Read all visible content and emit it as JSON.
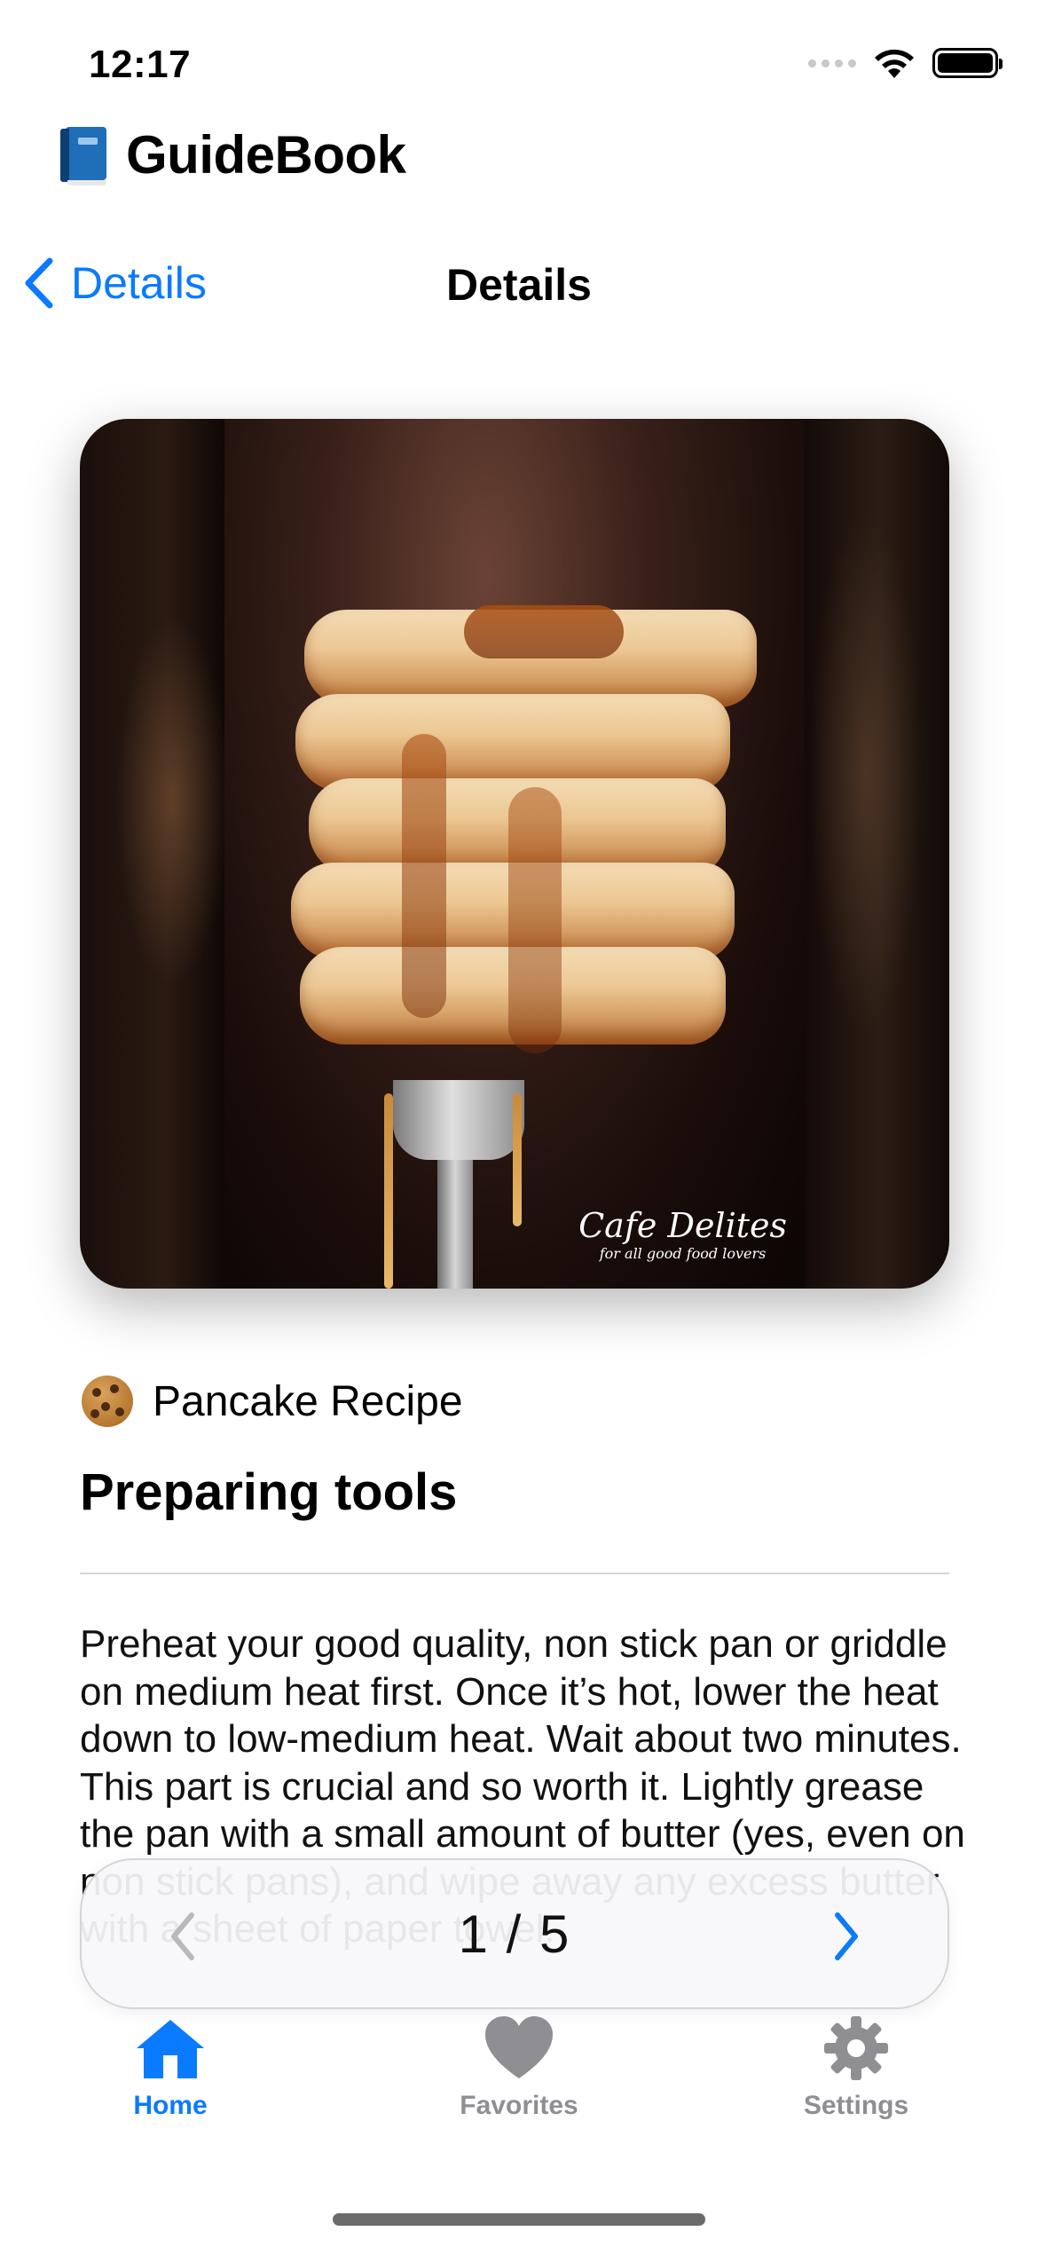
{
  "status_bar": {
    "time": "12:17"
  },
  "app": {
    "title": "GuideBook",
    "icon": "book-icon"
  },
  "nav": {
    "back_label": "Details",
    "title": "Details"
  },
  "hero": {
    "watermark_main": "Cafe Delites",
    "watermark_sub": "for all good food lovers"
  },
  "content": {
    "category_icon": "cookie-icon",
    "category": "Pancake Recipe",
    "title": "Preparing tools",
    "body": "Preheat your good quality, non stick pan or griddle on medium heat first. Once it’s hot, lower the heat down to low-medium heat. Wait about two minutes. This part is crucial and so worth it. Lightly grease the pan with a small amount of butter (yes, even on non stick pans), and wipe away any excess butter with a sheet of paper towel."
  },
  "pager": {
    "current": 1,
    "total": 5,
    "label": "1 / 5"
  },
  "tabbar": {
    "items": [
      {
        "label": "Home",
        "icon": "house-icon",
        "selected": true
      },
      {
        "label": "Favorites",
        "icon": "heart-icon",
        "selected": false
      },
      {
        "label": "Settings",
        "icon": "gear-icon",
        "selected": false
      }
    ]
  },
  "colors": {
    "accent": "#0a7aff",
    "inactive": "#8e8e93"
  }
}
